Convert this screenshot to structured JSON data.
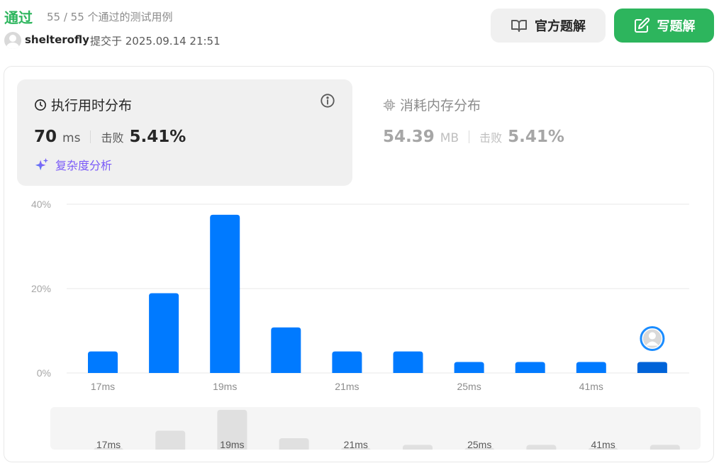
{
  "header": {
    "status": "通过",
    "passed_count": "55 / 55 个通过的测试用例",
    "username": "shelterofly",
    "submitted_at": "提交于 2025.09.14 21:51"
  },
  "buttons": {
    "official_solution": "官方题解",
    "write_solution": "写题解"
  },
  "runtime": {
    "title": "执行用时分布",
    "value": "70",
    "unit": "ms",
    "beat_label": "击败",
    "beat_value": "5.41%",
    "analysis_link": "复杂度分析"
  },
  "memory": {
    "title": "消耗内存分布",
    "value": "54.39",
    "unit": "MB",
    "beat_label": "击败",
    "beat_value": "5.41%"
  },
  "colors": {
    "accepted": "#2db55d",
    "bar": "#007aff",
    "bar_highlight": "#0063d8",
    "link": "#7a5af8"
  },
  "chart_data": {
    "type": "bar",
    "title": "",
    "xlabel": "",
    "ylabel": "",
    "ylim": [
      0,
      40
    ],
    "y_ticks": [
      "0%",
      "20%",
      "40%"
    ],
    "x_tick_labels": [
      "17ms",
      "",
      "19ms",
      "",
      "21ms",
      "",
      "25ms",
      "",
      "41ms",
      ""
    ],
    "values": [
      5.1,
      18.9,
      37.5,
      10.8,
      5.1,
      5.1,
      2.6,
      2.6,
      2.6,
      2.6
    ],
    "highlight_index": 9,
    "grid": true,
    "minimap": {
      "labels": [
        "17ms",
        "",
        "19ms",
        "",
        "21ms",
        "",
        "25ms",
        "",
        "41ms",
        ""
      ],
      "values": [
        2,
        20,
        42,
        12,
        2,
        5,
        2,
        5,
        2,
        5
      ]
    }
  }
}
